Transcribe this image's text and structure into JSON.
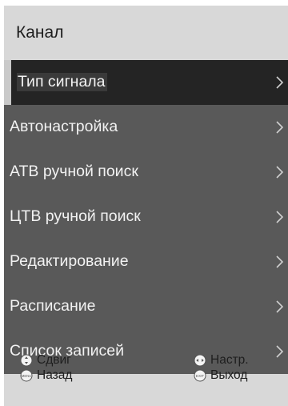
{
  "title": "Канал",
  "menu": {
    "items": [
      {
        "label": "Тип сигнала",
        "selected": true
      },
      {
        "label": "Автонастройка"
      },
      {
        "label": "АТВ ручной поиск"
      },
      {
        "label": "ЦТВ ручной поиск"
      },
      {
        "label": "Редактирование"
      },
      {
        "label": "Расписание"
      },
      {
        "label": "Список записей"
      }
    ]
  },
  "footer": {
    "move": "Сдвиг",
    "back": "Назад",
    "settings": "Настр.",
    "exit": "Выход",
    "back_icon_text": "MENU",
    "exit_icon_text": "EXIT"
  },
  "icons": {
    "chevron": "chevron-right-icon",
    "move": "up-down-nav-icon",
    "back": "menu-button-icon",
    "settings": "left-right-nav-icon",
    "exit": "exit-button-icon"
  },
  "colors": {
    "panel": "#d8d8d8",
    "row": "#595959",
    "row_selected": "#242424",
    "text_light": "#f2f2f2",
    "text_dark": "#1e1e1e"
  }
}
